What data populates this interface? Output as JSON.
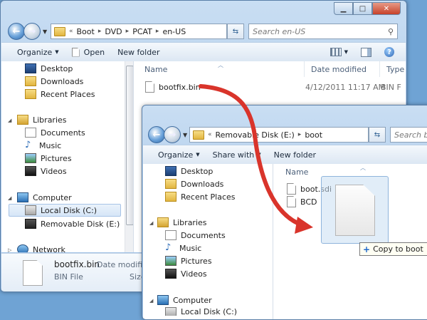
{
  "back_window": {
    "address": [
      "Boot",
      "DVD",
      "PCAT",
      "en-US"
    ],
    "search_placeholder": "Search en-US",
    "toolbar": {
      "organize": "Organize",
      "open": "Open",
      "new_folder": "New folder"
    },
    "nav": {
      "favorites": [
        "Desktop",
        "Downloads",
        "Recent Places"
      ],
      "libraries": "Libraries",
      "library_items": [
        "Documents",
        "Music",
        "Pictures",
        "Videos"
      ],
      "computer": "Computer",
      "computer_items": [
        "Local Disk (C:)",
        "Removable Disk (E:)"
      ],
      "network": "Network"
    },
    "columns": {
      "name": "Name",
      "date": "Date modified",
      "type": "Type"
    },
    "files": [
      {
        "name": "bootfix.bin",
        "date": "4/12/2011 11:17 AM",
        "type": "BIN F"
      }
    ],
    "details": {
      "name": "bootfix.bin",
      "date_label": "Date modified",
      "type": "BIN File",
      "size_label": "Size"
    }
  },
  "front_window": {
    "address": [
      "Removable Disk (E:)",
      "boot"
    ],
    "search_placeholder": "Search boot",
    "toolbar": {
      "organize": "Organize",
      "share": "Share with",
      "new_folder": "New folder"
    },
    "nav": {
      "favorites": [
        "Desktop",
        "Downloads",
        "Recent Places"
      ],
      "libraries": "Libraries",
      "library_items": [
        "Documents",
        "Music",
        "Pictures",
        "Videos"
      ],
      "computer": "Computer",
      "computer_partial": "Local Disk (C:)"
    },
    "columns": {
      "name": "Name"
    },
    "files": [
      "boot.sdi",
      "BCD"
    ]
  },
  "drag": {
    "tooltip": "Copy to boot",
    "arrow_color": "#d9342b"
  },
  "icons": [
    "back-icon",
    "forward-icon",
    "folder-icon",
    "refresh-icon",
    "search-icon",
    "help-icon",
    "view-icon",
    "preview-pane-icon",
    "file-icon"
  ]
}
